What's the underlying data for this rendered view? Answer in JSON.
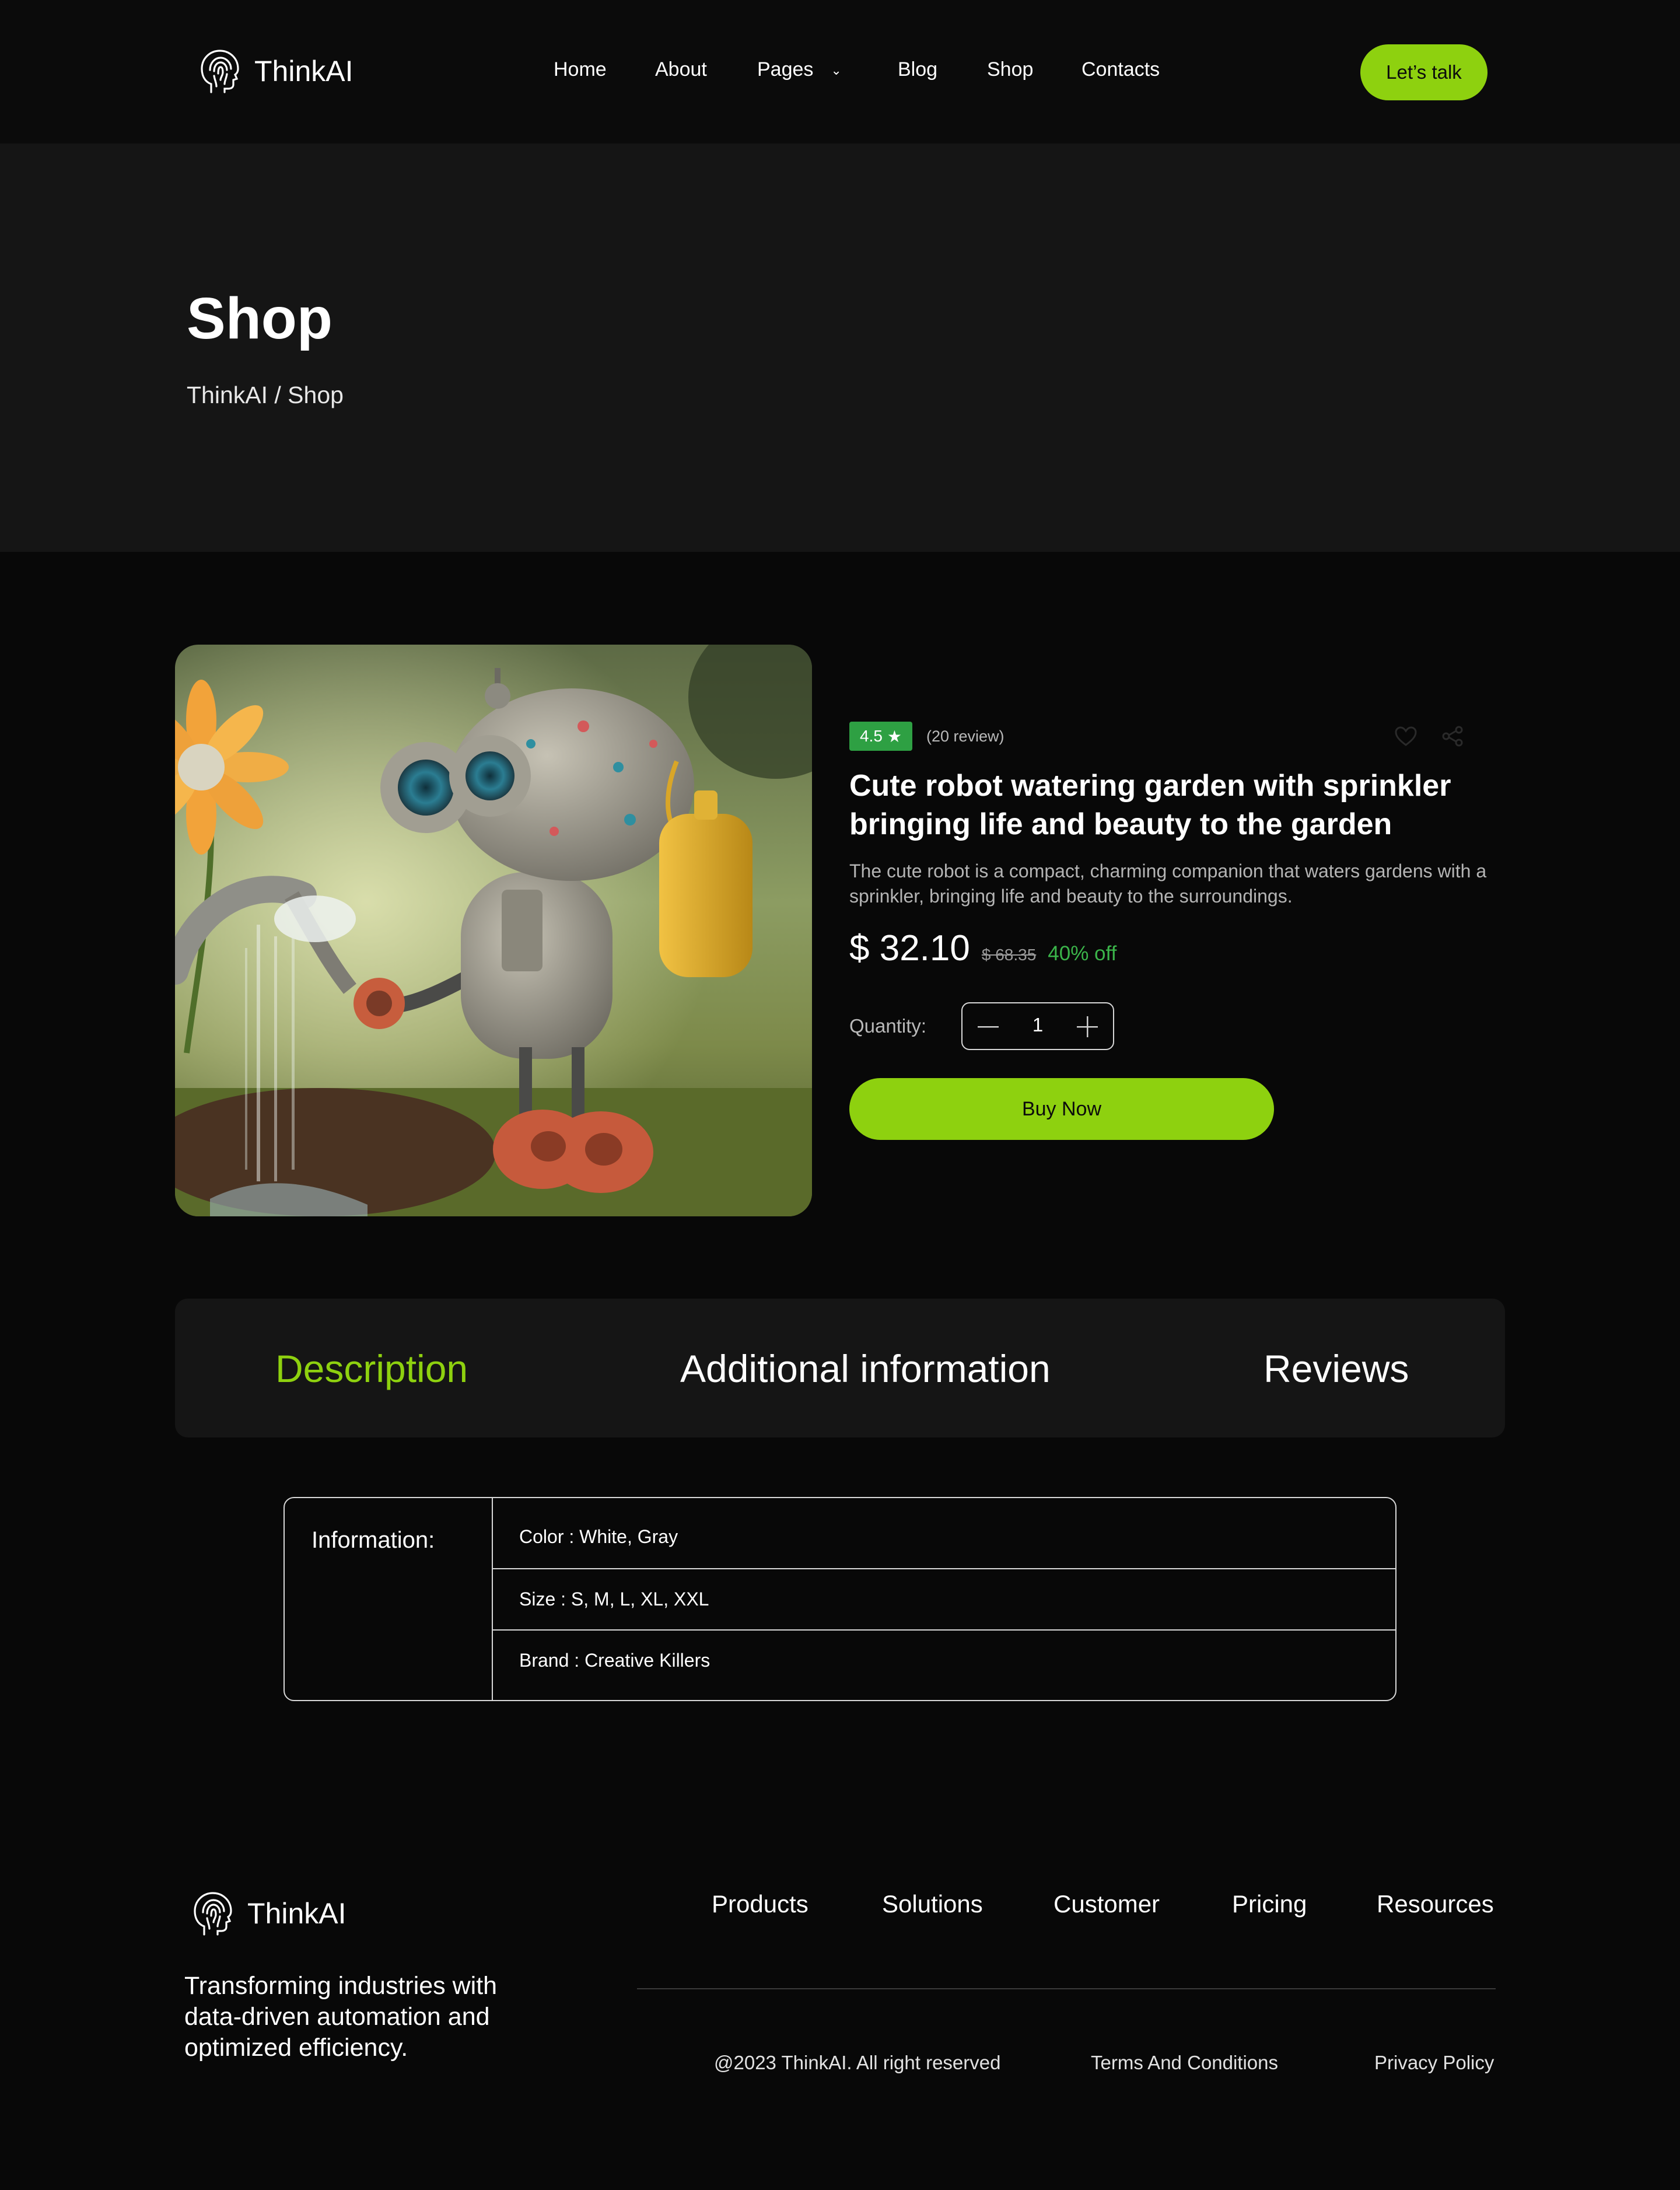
{
  "brand": {
    "name": "ThinkAI",
    "logo_icon": "head-fingerprint-icon",
    "accent_color": "#8ed10f"
  },
  "nav": {
    "items": [
      {
        "label": "Home"
      },
      {
        "label": "About"
      },
      {
        "label": "Pages",
        "icon": "chevron-down-icon"
      },
      {
        "label": "Blog"
      },
      {
        "label": "Shop"
      },
      {
        "label": "Contacts"
      }
    ],
    "cta_label": "Let’s talk"
  },
  "hero": {
    "title": "Shop",
    "breadcrumb": "ThinkAI / Shop"
  },
  "product": {
    "rating": "4.5",
    "rating_icon": "star-icon",
    "review_count": "(20 review)",
    "action_icons": [
      "heart-icon",
      "share-icon"
    ],
    "title": "Cute robot watering garden with sprinkler bringing life and beauty to the garden",
    "description": "The cute robot is a compact, charming companion that waters gardens with a sprinkler, bringing life and beauty to the surroundings.",
    "price": "$ 32.10",
    "old_price": "$ 68.35",
    "discount": "40% off",
    "discount_color": "#3bb54a",
    "quantity_label": "Quantity:",
    "quantity": "1",
    "buy_label": "Buy Now"
  },
  "tabs": {
    "items": [
      {
        "label": "Description",
        "active": true
      },
      {
        "label": "Additional information",
        "active": false
      },
      {
        "label": "Reviews",
        "active": false
      }
    ]
  },
  "info": {
    "label": "Information:",
    "rows": [
      {
        "text": "Color : White, Gray"
      },
      {
        "text": "Size : S, M, L, XL, XXL"
      },
      {
        "text": "Brand : Creative Killers"
      }
    ]
  },
  "footer": {
    "tagline": "Transforming industries with data-driven automation and optimized efficiency.",
    "links": [
      {
        "label": "Products"
      },
      {
        "label": "Solutions"
      },
      {
        "label": "Customer"
      },
      {
        "label": "Pricing"
      },
      {
        "label": "Resources"
      }
    ],
    "copyright": "@2023 ThinkAI. All right reserved",
    "terms": "Terms And Conditions",
    "privacy": "Privacy Policy"
  }
}
